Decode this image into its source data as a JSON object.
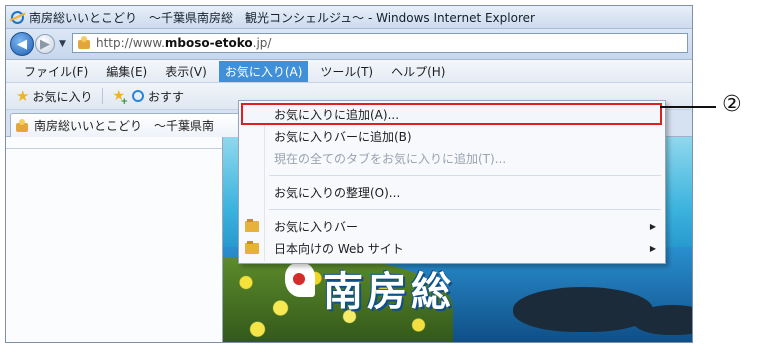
{
  "window": {
    "title": "南房総いいとこどり　～千葉県南房総　観光コンシェルジュ～ - Windows Internet Explorer"
  },
  "address_bar": {
    "url_prefix": "http://www.",
    "url_host": "mboso-etoko",
    "url_suffix": ".jp/"
  },
  "menubar": {
    "items": [
      {
        "label": "ファイル(F)"
      },
      {
        "label": "編集(E)"
      },
      {
        "label": "表示(V)"
      },
      {
        "label": "お気に入り(A)",
        "active": true
      },
      {
        "label": "ツール(T)"
      },
      {
        "label": "ヘルプ(H)"
      }
    ]
  },
  "favorites_bar": {
    "favorites_label": "お気に入り",
    "suggested_label": "おすす"
  },
  "tab": {
    "title": "南房総いいとこどり　～千葉県南"
  },
  "banner": {
    "logo_text": "南房総"
  },
  "favorites_menu": {
    "items": [
      {
        "label": "お気に入りに追加(A)...",
        "highlighted": true
      },
      {
        "label": "お気に入りバーに追加(B)"
      },
      {
        "label": "現在の全てのタブをお気に入りに追加(T)...",
        "disabled": true
      },
      {
        "label": "お気に入りの整理(O)..."
      },
      {
        "label": "お気に入りバー",
        "submenu": true
      },
      {
        "label": "日本向けの Web サイト",
        "submenu": true
      }
    ]
  },
  "annotation": {
    "callout_number": "②",
    "highlight_color": "#e02020"
  },
  "colors": {
    "menu_active": "#3f8fd9",
    "window_frame": "#cfdcec"
  }
}
